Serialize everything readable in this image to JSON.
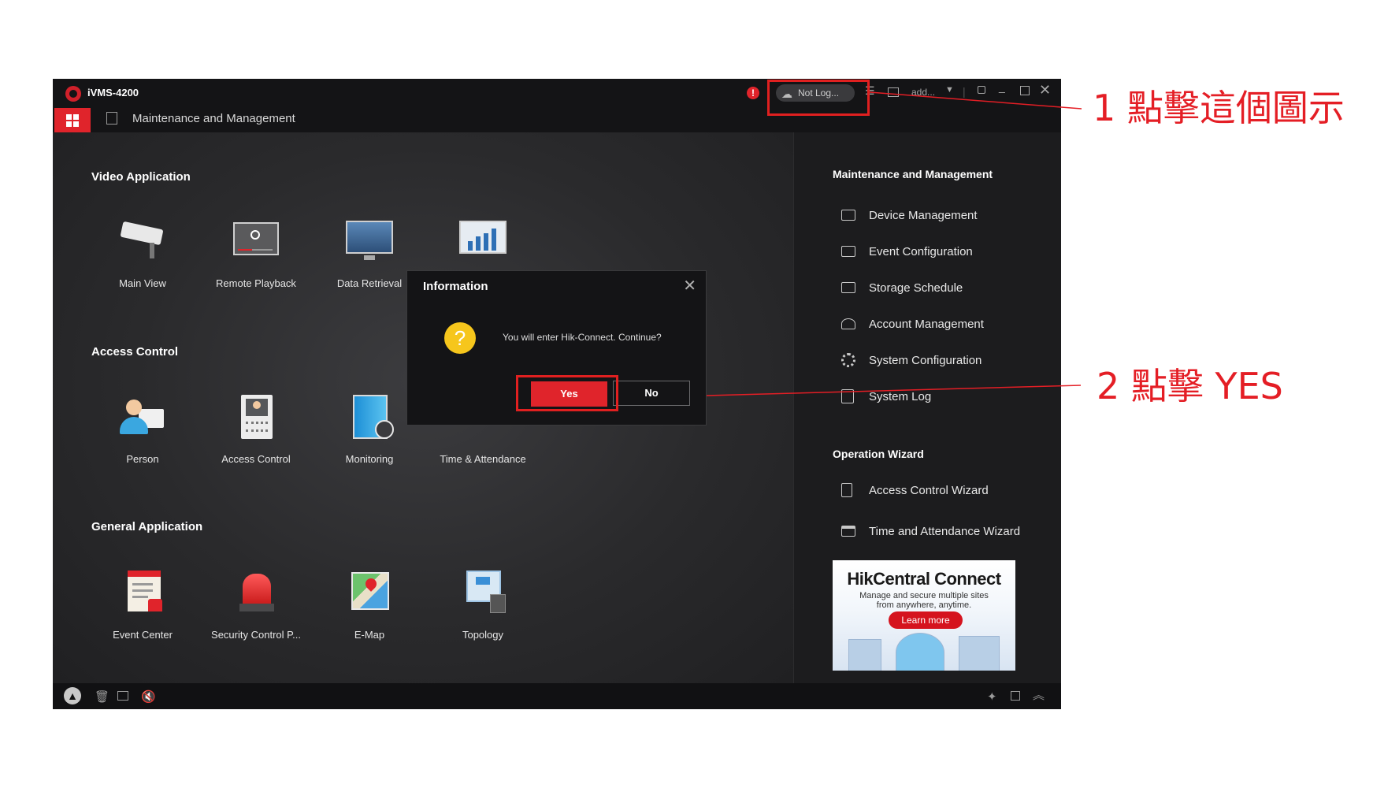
{
  "app": {
    "title": "iVMS-4200",
    "tab_title": "Maintenance and Management"
  },
  "header": {
    "login_status": "Not Log...",
    "user": "add...",
    "alert_glyph": "!"
  },
  "sections": {
    "video": {
      "title": "Video Application",
      "items": [
        {
          "label": "Main View",
          "icon": "camera-icon"
        },
        {
          "label": "Remote Playback",
          "icon": "playback-icon"
        },
        {
          "label": "Data Retrieval",
          "icon": "monitor-icon"
        },
        {
          "label": "",
          "icon": "chart-monitor-icon"
        }
      ]
    },
    "access": {
      "title": "Access Control",
      "items": [
        {
          "label": "Person",
          "icon": "person-icon"
        },
        {
          "label": "Access Control",
          "icon": "door-terminal-icon"
        },
        {
          "label": "Monitoring",
          "icon": "door-monitor-icon"
        },
        {
          "label": "Time & Attendance",
          "icon": "attendance-icon"
        }
      ]
    },
    "general": {
      "title": "General Application",
      "items": [
        {
          "label": "Event Center",
          "icon": "event-icon"
        },
        {
          "label": "Security Control P...",
          "icon": "alarm-icon"
        },
        {
          "label": "E-Map",
          "icon": "map-icon"
        },
        {
          "label": "Topology",
          "icon": "topology-icon"
        }
      ]
    }
  },
  "sidebar": {
    "mm_title": "Maintenance and Management",
    "mm_items": [
      {
        "label": "Device Management",
        "icon": "device-icon"
      },
      {
        "label": "Event Configuration",
        "icon": "event-config-icon"
      },
      {
        "label": "Storage Schedule",
        "icon": "storage-icon"
      },
      {
        "label": "Account Management",
        "icon": "account-icon"
      },
      {
        "label": "System Configuration",
        "icon": "gear-icon"
      },
      {
        "label": "System Log",
        "icon": "log-icon"
      }
    ],
    "wizard_title": "Operation Wizard",
    "wizard_items": [
      {
        "label": "Access Control Wizard",
        "icon": "wizard-door-icon"
      },
      {
        "label": "Time and Attendance Wizard",
        "icon": "calendar-icon"
      }
    ],
    "ad": {
      "title": "HikCentral Connect",
      "line1": "Manage and secure multiple sites",
      "line2": "from anywhere, anytime.",
      "button": "Learn more"
    }
  },
  "dialog": {
    "title": "Information",
    "message": "You will enter Hik-Connect. Continue?",
    "yes": "Yes",
    "no": "No",
    "icon_glyph": "?"
  },
  "annotations": {
    "step1": "1 點擊這個圖示",
    "step2": "2 點擊 YES"
  },
  "colors": {
    "accent_red": "#e0242b",
    "annotation_red": "#e41e25",
    "question_yellow": "#f6c61c"
  }
}
